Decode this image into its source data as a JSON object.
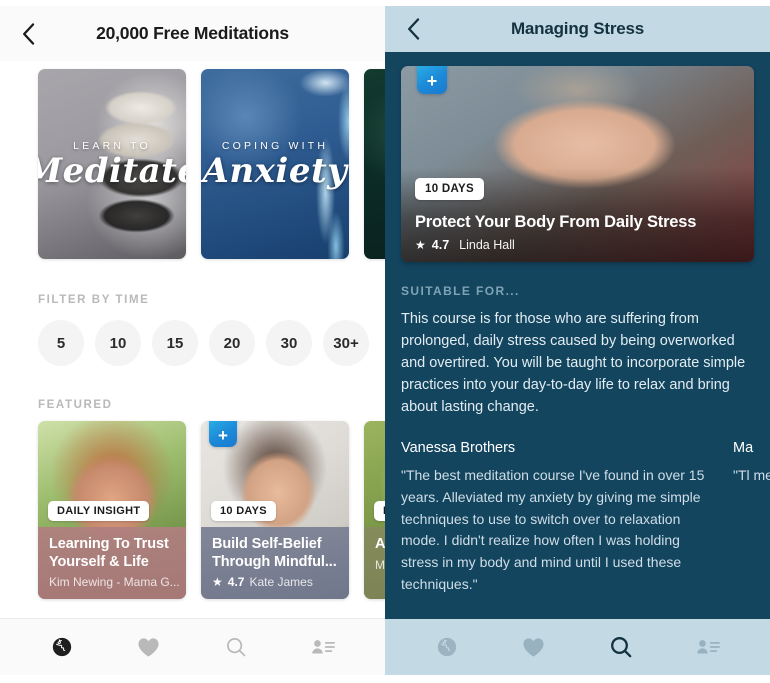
{
  "left": {
    "header": {
      "back_icon": "chevron-left-icon",
      "title": "20,000 Free Meditations"
    },
    "category_cards": [
      {
        "kicker": "LEARN TO",
        "script": "Meditate"
      },
      {
        "kicker": "COPING WITH",
        "script": "Anxiety"
      },
      {
        "kicker": "",
        "script": ""
      }
    ],
    "filter": {
      "label": "FILTER BY TIME",
      "options": [
        "5",
        "10",
        "15",
        "20",
        "30",
        "30+"
      ]
    },
    "featured": {
      "label": "FEATURED",
      "cards": [
        {
          "badge": "DAILY INSIGHT",
          "title": "Learning To Trust Yourself & Life",
          "author": "Kim Newing - Mama G...",
          "rating": "",
          "has_plus": false
        },
        {
          "badge": "10 DAYS",
          "title": "Build Self-Belief Through Mindful...",
          "author": "Kate James",
          "rating": "4.7",
          "has_plus": true
        },
        {
          "badge": "DA",
          "title": "Aw Bal",
          "author": "Mat",
          "rating": "",
          "has_plus": false
        }
      ]
    },
    "nav": [
      {
        "icon": "globe-icon",
        "active": true
      },
      {
        "icon": "heart-icon",
        "active": false
      },
      {
        "icon": "search-icon",
        "active": false
      },
      {
        "icon": "contact-list-icon",
        "active": false
      }
    ]
  },
  "right": {
    "header": {
      "back_icon": "chevron-left-icon",
      "title": "Managing Stress"
    },
    "hero": {
      "plus_label": "+",
      "badge": "10 DAYS",
      "title": "Protect Your Body From Daily Stress",
      "star_icon": "star-icon",
      "rating": "4.7",
      "author": "Linda Hall"
    },
    "suitable_label": "SUITABLE FOR...",
    "description": "This course is for those who are suffering from prolonged, daily stress caused by being overworked and overtired. You will be taught to incorporate simple practices into your day-to-day life to relax and bring about lasting change.",
    "testimonials": [
      {
        "name": "Vanessa Brothers",
        "text": "\"The best meditation course I've found in over 15 years. Alleviated my anxiety by giving me simple techniques to use to switch over to relaxation mode. I didn't realize how often I was holding stress in my body and mind until I used these techniques.\""
      },
      {
        "name": "Ma",
        "text": "\"Tl me rel exp fol hig"
      }
    ],
    "nav": [
      {
        "icon": "globe-icon",
        "active": false
      },
      {
        "icon": "heart-icon",
        "active": false
      },
      {
        "icon": "search-icon",
        "active": true
      },
      {
        "icon": "contact-list-icon",
        "active": false
      }
    ]
  },
  "colors": {
    "right_bg": "#13455f",
    "right_header_bg": "#c3d9e4",
    "plus_badge": "#1d8ad8",
    "chip_bg": "#f4f4f4"
  }
}
